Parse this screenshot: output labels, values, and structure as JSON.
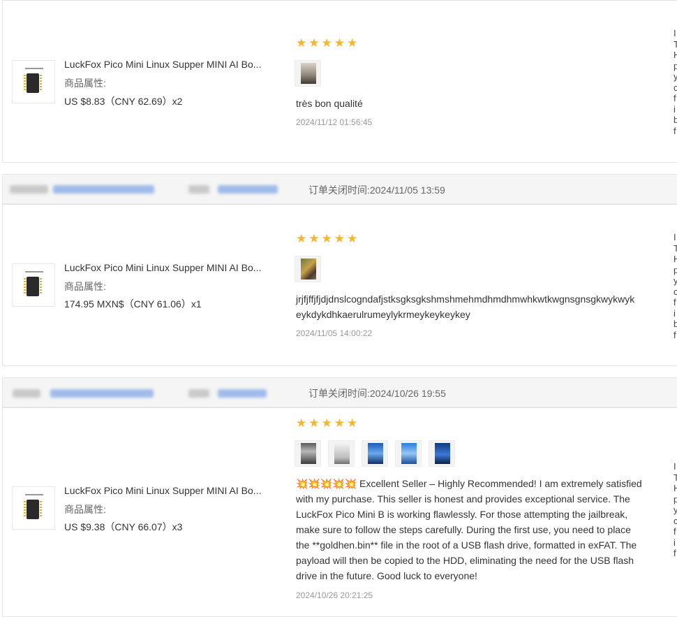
{
  "orders": [
    {
      "product_title": "LuckFox Pico Mini Linux Supper MINI AI Bo...",
      "attr_label": "商品属性:",
      "price": "US $8.83（CNY  62.69）x2",
      "stars": "★★★★★",
      "review": "très bon qualité",
      "review_date": "2024/11/12 01:56:45"
    },
    {
      "close_time": "订单关闭时间:2024/11/05 13:59",
      "product_title": "LuckFox Pico Mini Linux Supper MINI AI Bo...",
      "attr_label": "商品属性:",
      "price": "174.95 MXN$（CNY  61.06）x1",
      "stars": "★★★★★",
      "review_line1": "jrjfjffjfjdjdnslcogndafjstksgksgkshmshmehmdhmdhmwhkwtkwgnsgnsgkwykwyk",
      "review_line2": "eykdykdhkaerulrumeylykrmeykeykeykey",
      "review_date": "2024/11/05 14:00:22"
    },
    {
      "close_time": "订单关闭时间:2024/10/26 19:55",
      "product_title": "LuckFox Pico Mini Linux Supper MINI AI Bo...",
      "attr_label": "商品属性:",
      "price": "US $9.38（CNY  66.07）x3",
      "stars": "★★★★★",
      "review_lines": [
        "💥💥💥💥💥 Excellent Seller – Highly Recommended! I am extremely satisfied",
        "with my purchase. This seller is honest and provides exceptional service. The",
        "LuckFox Pico Mini B is working flawlessly. For those attempting the jailbreak,",
        "make sure to follow the steps carefully. During the first use, you need to place",
        "the **goldhen.bin** file in the root of a USB flash drive, formatted in exFAT. The",
        "payload will then be copied to the HDD, eliminating the need for the USB flash",
        "drive in the future. Good luck to everyone!"
      ],
      "review_date": "2024/10/26 20:21:25"
    }
  ],
  "edge_letters": {
    "block1": [
      "I",
      "T",
      "H",
      "p",
      "y",
      "c",
      "f",
      "i",
      "b",
      "f"
    ],
    "block2": [
      "I",
      "T",
      "H",
      "p",
      "y",
      "c",
      "f",
      "i",
      "b",
      "f"
    ],
    "block3": [
      "I",
      "T",
      "H",
      "p",
      "y",
      "c",
      "f",
      "i",
      "f"
    ]
  },
  "colors": {
    "star": "#f7b52c",
    "band": "#f5f5f5",
    "muted": "#999999"
  }
}
